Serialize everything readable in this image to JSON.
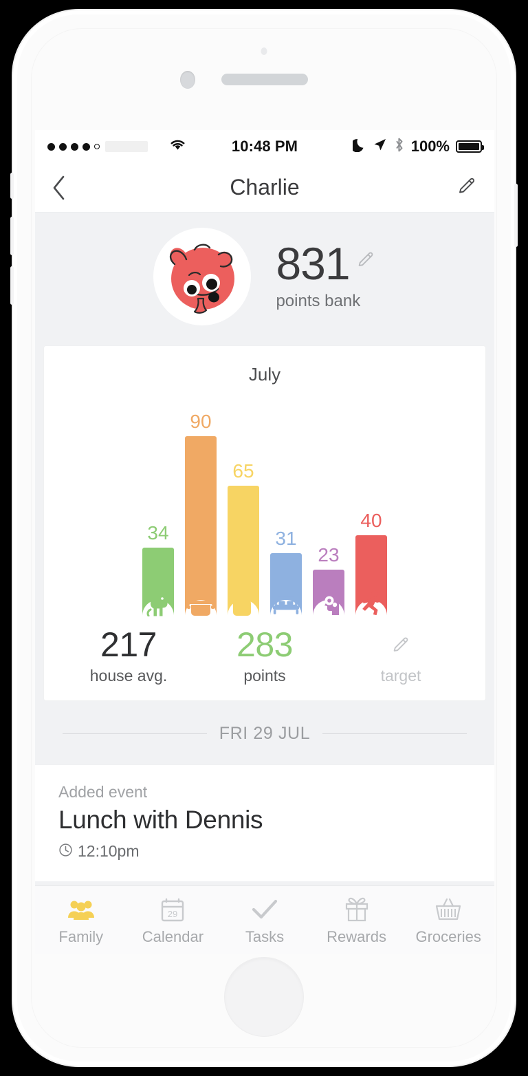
{
  "status_bar": {
    "signal_dots_filled": 4,
    "signal_dots_total": 5,
    "wifi_icon": "wifi-icon",
    "time": "10:48 PM",
    "do_not_disturb_icon": "moon-icon",
    "location_icon": "location-arrow-icon",
    "bluetooth_icon": "bluetooth-icon",
    "battery_percent": "100%"
  },
  "nav": {
    "back_icon": "chevron-left-icon",
    "title": "Charlie",
    "edit_icon": "pencil-icon"
  },
  "profile": {
    "avatar_icon": "dog-avatar",
    "points_value": "831",
    "points_edit_icon": "pencil-icon",
    "points_label": "points bank"
  },
  "chart_card": {
    "month": "July",
    "stats": [
      {
        "value": "217",
        "label": "house avg.",
        "color": "#2f3032"
      },
      {
        "value": "283",
        "label": "points",
        "color": "#8DCC74"
      },
      {
        "value": "",
        "label": "target",
        "color": "#c2c4c7",
        "icon": "pencil-icon"
      }
    ]
  },
  "chart_data": {
    "type": "bar",
    "title": "July",
    "xlabel": "",
    "ylabel": "",
    "ylim": [
      0,
      100
    ],
    "grid": false,
    "legend": "none",
    "categories": [
      "pet",
      "cooking",
      "cleaning",
      "bed",
      "homework",
      "exercise"
    ],
    "category_icons": [
      "dog-icon",
      "cooking-pot-icon",
      "spray-bottle-icon",
      "bed-icon",
      "head-gear-icon",
      "running-person-icon"
    ],
    "values": [
      34,
      90,
      65,
      31,
      23,
      40
    ],
    "colors": [
      "#8DCC74",
      "#F0A964",
      "#F7D463",
      "#8EB1E0",
      "#BA7EBE",
      "#EB5F5D"
    ],
    "data_labels": [
      "34",
      "90",
      "65",
      "31",
      "23",
      "40"
    ],
    "summary": {
      "house_avg": 217,
      "points": 283,
      "target": null
    }
  },
  "timeline": {
    "date_divider": "FRI 29 JUL",
    "event": {
      "kicker": "Added event",
      "title": "Lunch with Dennis",
      "clock_icon": "clock-icon",
      "time": "12:10pm"
    }
  },
  "tab_bar": {
    "active_color": "#F5D055",
    "inactive_color": "#c8cacd",
    "items": [
      {
        "label": "Family",
        "icon": "people-icon",
        "active": true
      },
      {
        "label": "Calendar",
        "icon": "calendar-icon",
        "active": false,
        "day": "29"
      },
      {
        "label": "Tasks",
        "icon": "check-icon",
        "active": false
      },
      {
        "label": "Rewards",
        "icon": "gift-icon",
        "active": false
      },
      {
        "label": "Groceries",
        "icon": "basket-icon",
        "active": false
      }
    ]
  }
}
